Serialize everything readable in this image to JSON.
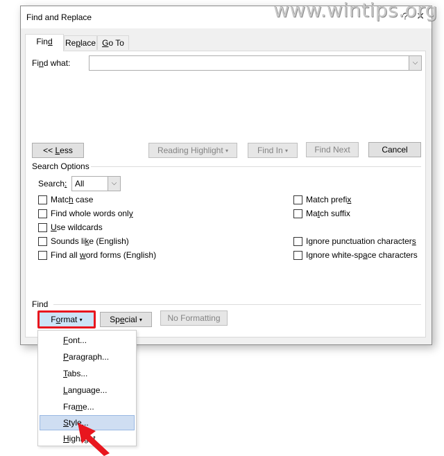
{
  "window": {
    "title": "Find and Replace",
    "help_glyph": "?",
    "close_glyph": "✕",
    "watermark": "www.wintips.org"
  },
  "tabs": [
    {
      "label_pre": "Fin",
      "label_u": "d",
      "label_post": "",
      "active": true
    },
    {
      "label_pre": "Re",
      "label_u": "p",
      "label_post": "lace",
      "active": false
    },
    {
      "label_pre": "",
      "label_u": "G",
      "label_post": "o To",
      "active": false
    }
  ],
  "find_what": {
    "label_pre": "Fi",
    "label_u": "n",
    "label_post": "d what:",
    "value": "",
    "dropdown_glyph": "⌵"
  },
  "buttons": {
    "less_pre": "<< ",
    "less_u": "L",
    "less_post": "ess",
    "reading_highlight": "Reading Highlight",
    "find_in": "Find In",
    "find_next": "Find Next",
    "cancel": "Cancel",
    "caret": "▾"
  },
  "search_options": {
    "title": "Search Options",
    "search_label_pre": "Search",
    "search_label_u": ":",
    "search_value": "All",
    "left_checkboxes": [
      {
        "pre": "Matc",
        "u": "h",
        "post": " case",
        "checked": false
      },
      {
        "pre": "Find whole words onl",
        "u": "y",
        "post": "",
        "checked": false
      },
      {
        "pre": "",
        "u": "U",
        "post": "se wildcards",
        "checked": false
      },
      {
        "pre": "Sounds li",
        "u": "k",
        "post": "e (English)",
        "checked": false
      },
      {
        "pre": "Find all ",
        "u": "w",
        "post": "ord forms (English)",
        "checked": false
      }
    ],
    "right_checkboxes": [
      {
        "pre": "Match prefi",
        "u": "x",
        "post": "",
        "checked": false
      },
      {
        "pre": "Ma",
        "u": "t",
        "post": "ch suffix",
        "checked": false
      },
      {
        "pre": "Ignore punctuation character",
        "u": "s",
        "post": "",
        "checked": false
      },
      {
        "pre": "Ignore white-sp",
        "u": "a",
        "post": "ce characters",
        "checked": false
      }
    ]
  },
  "find_section": {
    "title": "Find",
    "format_pre": "F",
    "format_u": "o",
    "format_post": "rmat",
    "special_pre": "Sp",
    "special_u": "e",
    "special_post": "cial",
    "no_formatting": "No Formatting"
  },
  "format_menu": {
    "items": [
      {
        "u": "F",
        "post": "ont...",
        "hover": false
      },
      {
        "u": "P",
        "post": "aragraph...",
        "hover": false
      },
      {
        "u": "T",
        "post": "abs...",
        "hover": false
      },
      {
        "u": "L",
        "post": "anguage...",
        "hover": false
      },
      {
        "pre": "Fra",
        "u": "m",
        "post": "e...",
        "hover": false
      },
      {
        "u": "S",
        "post": "tyle...",
        "hover": true
      },
      {
        "u": "H",
        "post": "ighlight",
        "hover": false
      }
    ]
  },
  "annotation": {
    "highlight_color": "#e8161e",
    "arrow_color": "#e8161e"
  }
}
